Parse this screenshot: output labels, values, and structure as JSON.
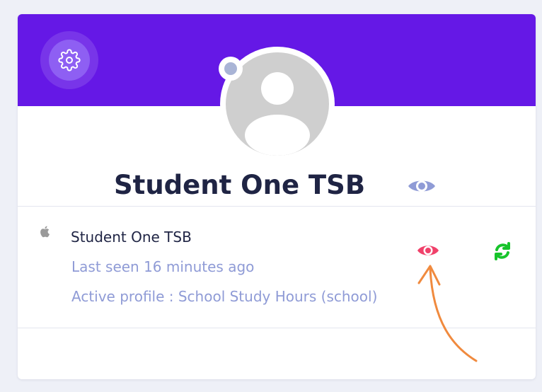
{
  "profile": {
    "name": "Student One TSB"
  },
  "device": {
    "name": "Student One TSB",
    "last_seen": "Last seen 16 minutes ago",
    "active_profile": "Active profile : School Study Hours (school)"
  },
  "icons": {
    "settings": "gear-icon",
    "title_eye": "eye-icon",
    "platform": "apple-icon",
    "view": "eye-icon",
    "refresh": "refresh-icon",
    "avatar": "user-placeholder-icon"
  },
  "colors": {
    "banner": "#6518e6",
    "title_text": "#1f2444",
    "muted_text": "#8f9bd6",
    "view_eye": "#f0416a",
    "refresh": "#17c42b",
    "annotation_arrow": "#f08a3e"
  }
}
